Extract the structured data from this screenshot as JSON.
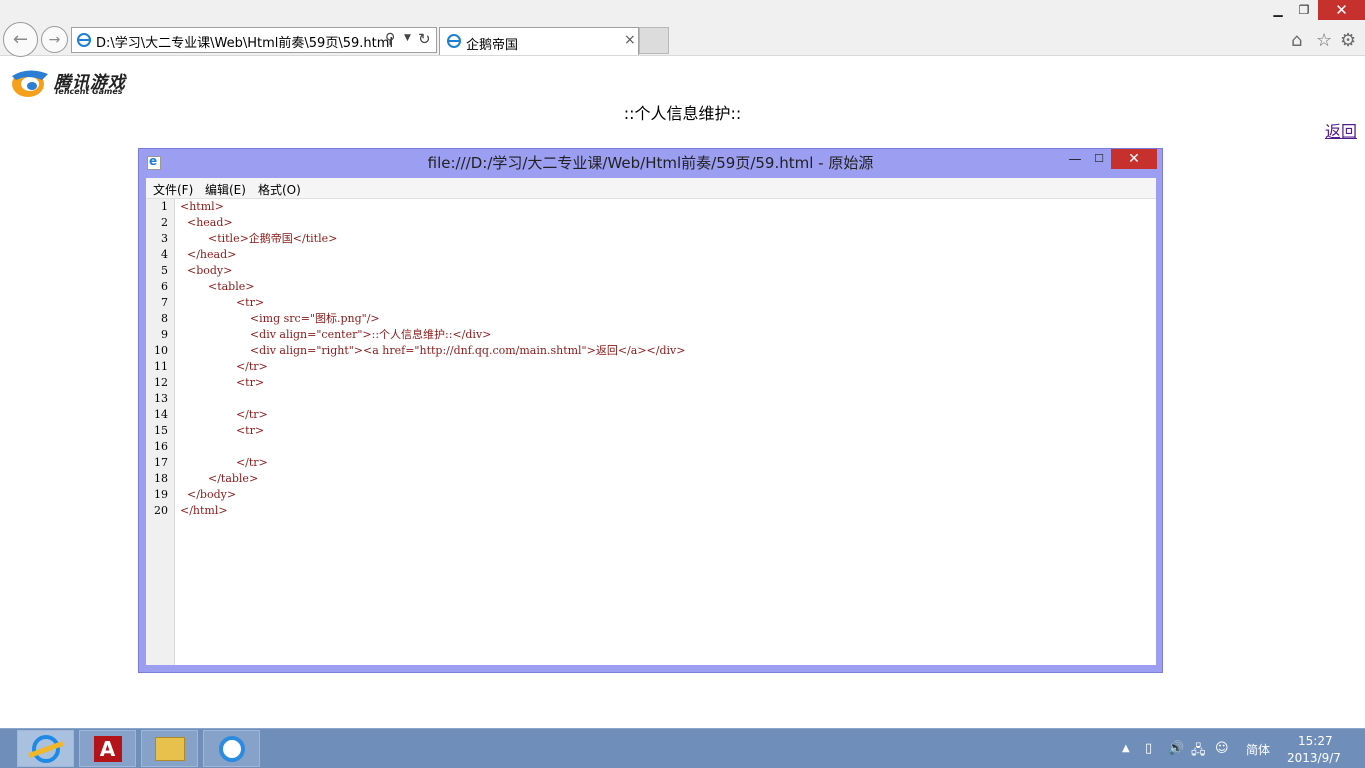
{
  "browser": {
    "address": "D:\\学习\\大二专业课\\Web\\Html前奏\\59页\\59.html",
    "tab_title": "企鹅帝国",
    "tab_close": "×",
    "icons": {
      "back": "back-arrow-icon",
      "forward": "forward-arrow-icon",
      "search": "search-icon",
      "refresh": "refresh-icon",
      "home": "home-icon",
      "favorites": "star-icon",
      "tools": "gear-icon"
    }
  },
  "page": {
    "logo_text": "腾讯游戏",
    "logo_sub": "Tencent Games",
    "heading": "::个人信息维护::",
    "back_link": "返回"
  },
  "source_window": {
    "title": "file:///D:/学习/大二专业课/Web/Html前奏/59页/59.html - 原始源",
    "close": "✕",
    "menu": {
      "file": "文件(F)",
      "edit": "编辑(E)",
      "format": "格式(O)"
    },
    "lines": [
      {
        "n": "1",
        "text": "<html>"
      },
      {
        "n": "2",
        "text": "  <head>"
      },
      {
        "n": "3",
        "text": "        <title>企鹅帝国</title>"
      },
      {
        "n": "4",
        "text": "  </head>"
      },
      {
        "n": "5",
        "text": "  <body>"
      },
      {
        "n": "6",
        "text": "        <table>"
      },
      {
        "n": "7",
        "text": "                <tr>"
      },
      {
        "n": "8",
        "text": "                    <img src=\"图标.png\"/>"
      },
      {
        "n": "9",
        "text": "                    <div align=\"center\">::个人信息维护::</div>"
      },
      {
        "n": "10",
        "text": "                    <div align=\"right\"><a href=\"http://dnf.qq.com/main.shtml\">返回</a></div>"
      },
      {
        "n": "11",
        "text": "                </tr>"
      },
      {
        "n": "12",
        "text": "                <tr>"
      },
      {
        "n": "13",
        "text": ""
      },
      {
        "n": "14",
        "text": "                </tr>"
      },
      {
        "n": "15",
        "text": "                <tr>"
      },
      {
        "n": "16",
        "text": ""
      },
      {
        "n": "17",
        "text": "                </tr>"
      },
      {
        "n": "18",
        "text": "        </table>"
      },
      {
        "n": "19",
        "text": "  </body>"
      },
      {
        "n": "20",
        "text": "</html>"
      }
    ]
  },
  "taskbar": {
    "apps": [
      "internet-explorer-icon",
      "adobe-acrobat-icon",
      "file-explorer-icon",
      "qq-browser-icon"
    ],
    "acrobat_letter": "A",
    "ime": "简体",
    "time": "15:27",
    "date": "2013/9/7"
  }
}
